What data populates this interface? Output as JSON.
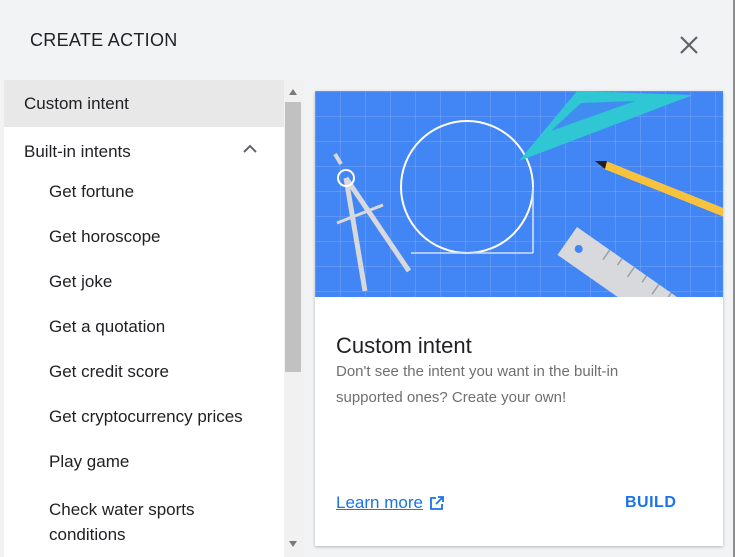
{
  "dialog": {
    "title": "CREATE ACTION"
  },
  "sidebar": {
    "custom_intent": "Custom intent",
    "builtin_header": "Built-in intents",
    "items": [
      "Get fortune",
      "Get horoscope",
      "Get joke",
      "Get a quotation",
      "Get credit score",
      "Get cryptocurrency prices",
      "Play game",
      "Check water sports conditions"
    ]
  },
  "card": {
    "title": "Custom intent",
    "description": "Don't see the intent you want in the built-in supported ones? Create your own!",
    "learn_more": "Learn more",
    "build": "BUILD"
  },
  "colors": {
    "accent": "#1a73e8",
    "illustration_bg": "#4285f4",
    "triangle": "#2fc7d4",
    "pencil": "#f9c23c"
  },
  "icons": [
    "close-icon",
    "chevron-up-icon",
    "external-link-icon",
    "scroll-up-arrow",
    "scroll-down-arrow"
  ]
}
